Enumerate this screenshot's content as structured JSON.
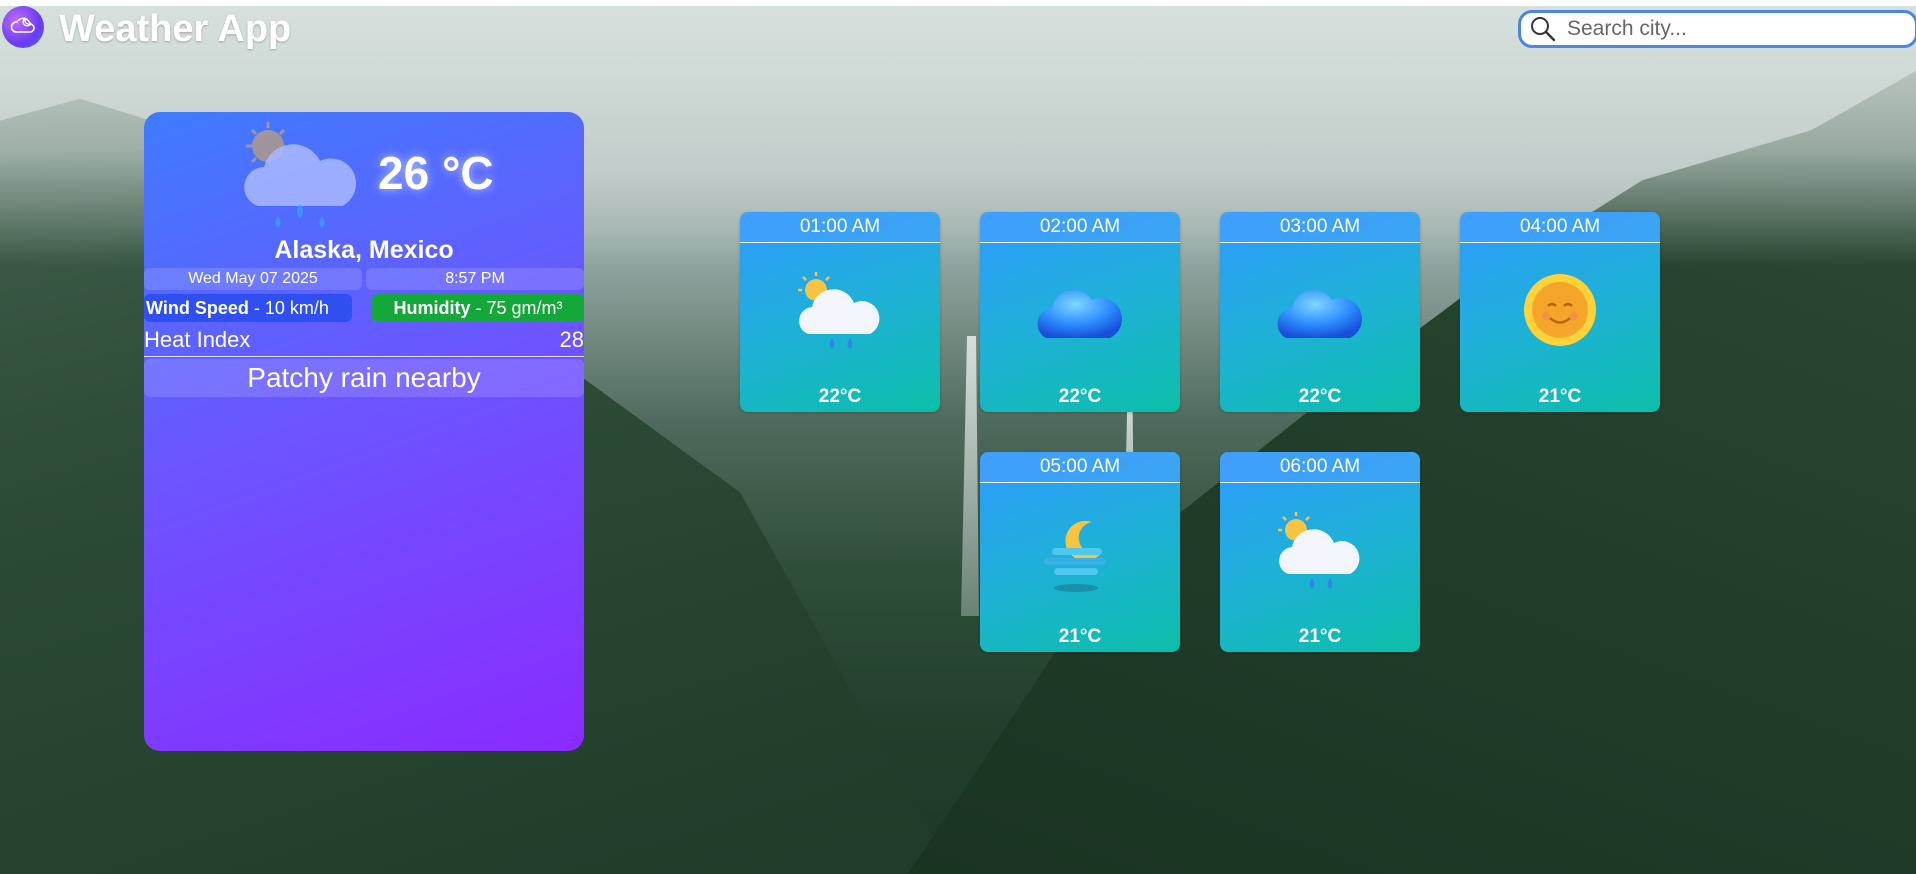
{
  "header": {
    "title": "Weather App",
    "logo_icon": "cloud-moon-icon"
  },
  "search": {
    "placeholder": "Search city...",
    "value": ""
  },
  "current": {
    "icon": "sun-cloud-rain-icon",
    "temperature": "26 °C",
    "location": "Alaska, Mexico",
    "date": "Wed May 07 2025",
    "time": "8:57 PM",
    "wind_label": "Wind Speed",
    "wind_value": "- 10 km/h",
    "humidity_label": "Humidity",
    "humidity_value": "- 75 gm/m³",
    "heat_index_label": "Heat Index",
    "heat_index_value": "28",
    "condition": "Patchy rain nearby"
  },
  "hourly": [
    {
      "time": "01:00 AM",
      "temp": "22°C",
      "icon": "sun-cloud-rain-icon"
    },
    {
      "time": "02:00 AM",
      "temp": "22°C",
      "icon": "cloud-icon"
    },
    {
      "time": "03:00 AM",
      "temp": "22°C",
      "icon": "cloud-icon"
    },
    {
      "time": "04:00 AM",
      "temp": "21°C",
      "icon": "smiling-sun-icon"
    },
    {
      "time": "05:00 AM",
      "temp": "21°C",
      "icon": "moon-fog-icon"
    },
    {
      "time": "06:00 AM",
      "temp": "21°C",
      "icon": "sun-cloud-rain-icon"
    }
  ],
  "colors": {
    "main_card_start": "#3f7bff",
    "main_card_end": "#8a2bff",
    "hour_card_start": "#2e9bff",
    "hour_card_end": "#0bbfa9",
    "wind_badge": "#2f4ff0",
    "humidity_badge": "#14a83a",
    "search_border": "#4a86e8"
  }
}
